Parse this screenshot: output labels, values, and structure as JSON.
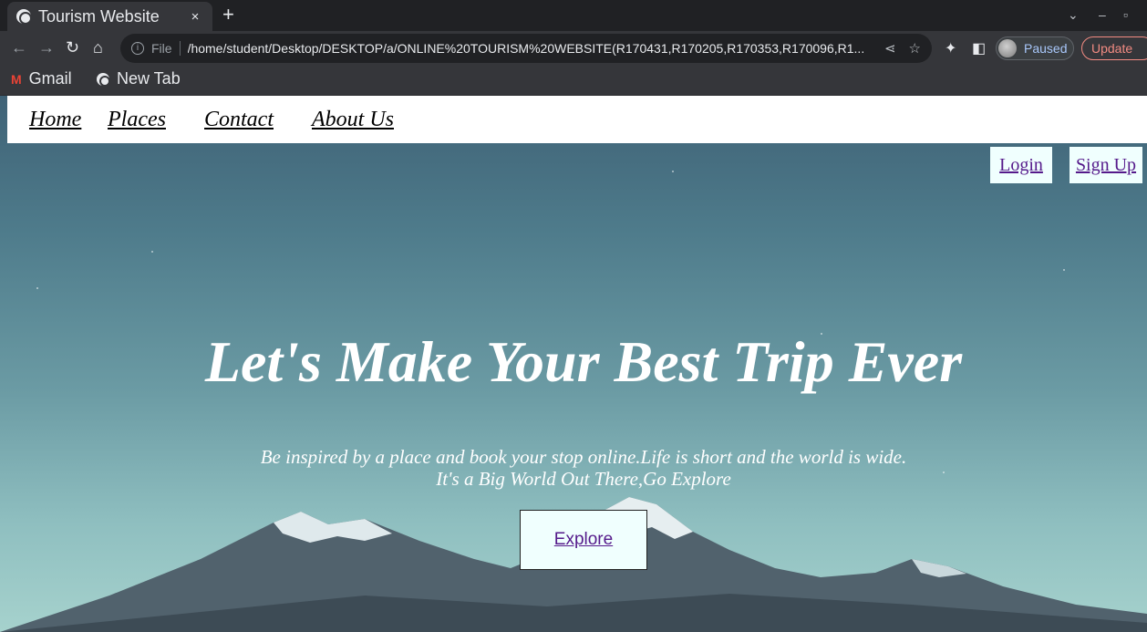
{
  "browser": {
    "tab_title": "Tourism Website",
    "tab_close": "×",
    "new_tab": "+",
    "scheme_label": "File",
    "url": "/home/student/Desktop/DESKTOP/a/ONLINE%20TOURISM%20WEBSITE(R170431,R170205,R170353,R170096,R1...",
    "profile_status": "Paused",
    "update_label": "Update"
  },
  "bookmarks": [
    {
      "label": "Gmail",
      "icon": "gmail-icon"
    },
    {
      "label": "New Tab",
      "icon": "globe-icon"
    }
  ],
  "page": {
    "nav": [
      "Home",
      "Places",
      "Contact",
      "About Us"
    ],
    "login_label": "Login",
    "signup_label": "Sign Up",
    "hero_title": "Let's Make Your Best Trip Ever",
    "hero_line1": "Be inspired by a place and book your stop online.Life is short and the world is wide.",
    "hero_line2": "It's a Big World Out There,Go Explore",
    "explore_label": "Explore"
  },
  "colors": {
    "link_visited": "#551a8b",
    "button_bg": "#f0fffe",
    "sky_top": "#3f6276",
    "sky_bottom": "#a6d2cd"
  }
}
